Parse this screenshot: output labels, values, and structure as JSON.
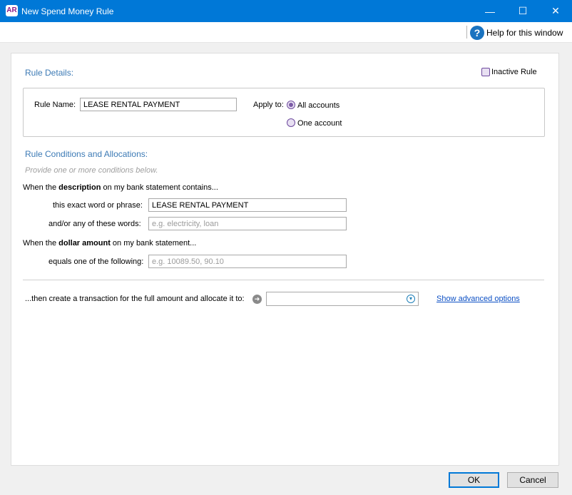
{
  "window": {
    "app_icon_text": "AR",
    "title": "New Spend Money Rule",
    "minimize": "—",
    "maximize": "☐",
    "close": "✕"
  },
  "help": {
    "icon": "?",
    "label": "Help for this window"
  },
  "rule_details": {
    "heading": "Rule Details:",
    "inactive_label": "Inactive Rule",
    "inactive_checked": false,
    "rule_name_label": "Rule Name:",
    "rule_name_value": "LEASE RENTAL PAYMENT",
    "apply_to_label": "Apply to:",
    "apply_options": [
      "All accounts",
      "One account"
    ],
    "apply_selected": "All accounts"
  },
  "conditions": {
    "heading": "Rule Conditions and Allocations:",
    "hint": "Provide one or more conditions below.",
    "desc_prefix": "When the ",
    "desc_bold": "description",
    "desc_suffix": " on my bank statement contains...",
    "exact_label": "this exact word or phrase:",
    "exact_value": "LEASE RENTAL PAYMENT",
    "any_label": "and/or any of these words:",
    "any_placeholder": "e.g. electricity, loan",
    "amount_prefix": "When the ",
    "amount_bold": "dollar amount",
    "amount_suffix": " on my bank statement...",
    "equals_label": "equals one of the following:",
    "equals_placeholder": "e.g. 10089.50, 90.10"
  },
  "allocation": {
    "label": "...then create a transaction for the full amount and allocate it to:",
    "arrow_icon": "➜",
    "account_value": "",
    "chevron": "▾",
    "advanced_link": "Show advanced options"
  },
  "footer": {
    "ok": "OK",
    "cancel": "Cancel"
  }
}
